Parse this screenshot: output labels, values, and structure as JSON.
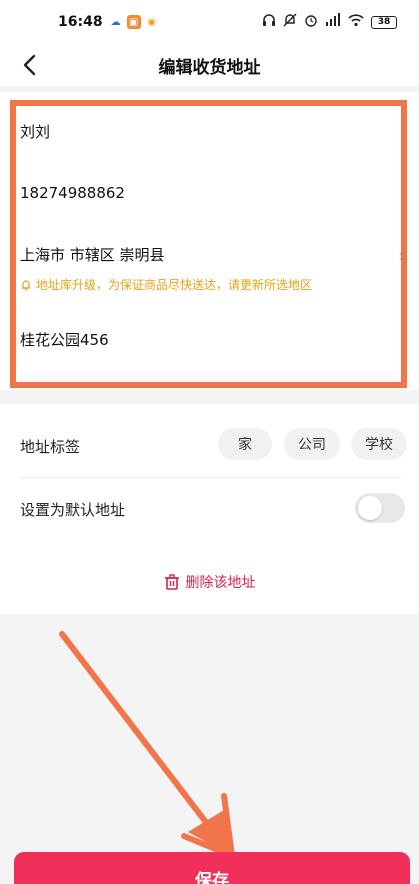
{
  "status_bar": {
    "time": "16:48",
    "battery": "38"
  },
  "nav": {
    "title": "编辑收货地址"
  },
  "address": {
    "name": "刘刘",
    "phone": "18274988862",
    "region": "上海市 市辖区 崇明县",
    "warning": "地址库升级，为保证商品尽快送达，请更新所选地区",
    "detail": "桂花公园456"
  },
  "tags": {
    "label": "地址标签",
    "options": [
      "家",
      "公司",
      "学校"
    ]
  },
  "default_address": {
    "label": "设置为默认地址",
    "enabled": false
  },
  "delete": {
    "label": "删除该地址"
  },
  "save": {
    "label": "保存"
  },
  "colors": {
    "accent": "#f0305b",
    "delete": "#d6244f",
    "warning": "#e8a317",
    "highlight": "#f2744a"
  }
}
